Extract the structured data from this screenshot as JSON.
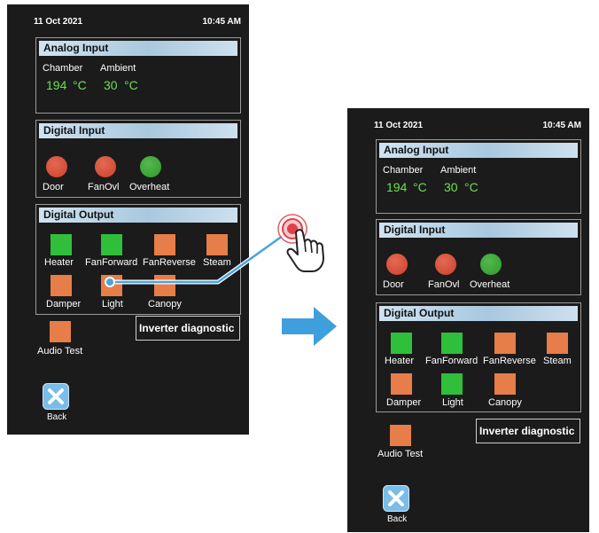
{
  "before": {
    "status_bar": {
      "date": "11 Oct 2021",
      "time": "10:45 AM"
    },
    "analog_input": {
      "title": "Analog Input",
      "chamber": {
        "label": "Chamber",
        "value": "194",
        "unit": "°C"
      },
      "ambient": {
        "label": "Ambient",
        "value": "30",
        "unit": "°C"
      }
    },
    "digital_input": {
      "title": "Digital Input",
      "items": [
        {
          "label": "Door",
          "state": "red"
        },
        {
          "label": "FanOvl",
          "state": "red"
        },
        {
          "label": "Overheat",
          "state": "green"
        }
      ]
    },
    "digital_output": {
      "title": "Digital Output",
      "items": [
        {
          "label": "Heater",
          "state": "green"
        },
        {
          "label": "FanForward",
          "state": "green"
        },
        {
          "label": "FanReverse",
          "state": "orange"
        },
        {
          "label": "Steam",
          "state": "orange"
        },
        {
          "label": "Damper",
          "state": "orange"
        },
        {
          "label": "Light",
          "state": "orange"
        },
        {
          "label": "Canopy",
          "state": "orange"
        }
      ]
    },
    "audio_test": {
      "label": "Audio Test",
      "state": "orange"
    },
    "inverter_button": {
      "label": "Inverter diagnostic"
    },
    "back_button": {
      "label": "Back"
    }
  },
  "after": {
    "status_bar": {
      "date": "11 Oct 2021",
      "time": "10:45 AM"
    },
    "analog_input": {
      "title": "Analog Input",
      "chamber": {
        "label": "Chamber",
        "value": "194",
        "unit": "°C"
      },
      "ambient": {
        "label": "Ambient",
        "value": "30",
        "unit": "°C"
      }
    },
    "digital_input": {
      "title": "Digital Input",
      "items": [
        {
          "label": "Door",
          "state": "red"
        },
        {
          "label": "FanOvl",
          "state": "red"
        },
        {
          "label": "Overheat",
          "state": "green"
        }
      ]
    },
    "digital_output": {
      "title": "Digital Output",
      "items": [
        {
          "label": "Heater",
          "state": "green"
        },
        {
          "label": "FanForward",
          "state": "green"
        },
        {
          "label": "FanReverse",
          "state": "orange"
        },
        {
          "label": "Steam",
          "state": "orange"
        },
        {
          "label": "Damper",
          "state": "orange"
        },
        {
          "label": "Light",
          "state": "green"
        },
        {
          "label": "Canopy",
          "state": "orange"
        }
      ]
    },
    "audio_test": {
      "label": "Audio Test",
      "state": "orange"
    },
    "inverter_button": {
      "label": "Inverter diagnostic"
    },
    "back_button": {
      "label": "Back"
    }
  },
  "icons": {
    "tap_gesture": "tap-hand-icon",
    "transition": "arrow-right-icon",
    "back": "close-x-icon"
  },
  "colors": {
    "screen_bg": "#1b1b1b",
    "value_text": "#6ee04e",
    "led_red": "#cc3f2b",
    "led_green": "#2f9a2c",
    "out_orange": "#e77d48",
    "out_green": "#2fbf3a",
    "panel_title": "#b7d1e4",
    "arrow": "#3f9fdc",
    "connector": "#4aa4e0",
    "tap_ring": "#e0404a"
  }
}
